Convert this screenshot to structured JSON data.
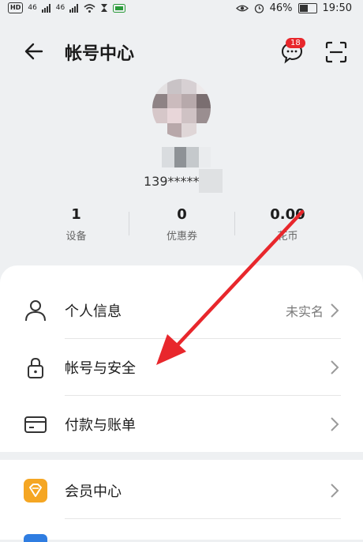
{
  "status_bar": {
    "left_icons": [
      "hd-icon",
      "signal-4g-icon",
      "signal-4g-icon",
      "wifi-icon",
      "hourglass-icon",
      "battery-saver-icon"
    ],
    "sim_badge": "HD",
    "net1": "46",
    "net2": "46",
    "battery_percent": "46%",
    "battery_level": 0.46,
    "time": "19:50"
  },
  "header": {
    "title": "帐号中心",
    "message_badge": "18"
  },
  "profile": {
    "phone_masked": "139*****"
  },
  "stats": [
    {
      "value": "1",
      "label": "设备"
    },
    {
      "value": "0",
      "label": "优惠券"
    },
    {
      "value": "0.00",
      "label": "花币"
    }
  ],
  "menu_primary": [
    {
      "label": "个人信息",
      "value": "未实名",
      "icon": "person-icon"
    },
    {
      "label": "帐号与安全",
      "value": "",
      "icon": "lock-icon"
    },
    {
      "label": "付款与账单",
      "value": "",
      "icon": "card-icon"
    }
  ],
  "menu_secondary": [
    {
      "label": "会员中心",
      "value": "",
      "icon": "vip-diamond-icon"
    }
  ],
  "colors": {
    "accent_red": "#e8272c",
    "vip_orange": "#f5a623",
    "page_bg": "#eef0f2"
  }
}
